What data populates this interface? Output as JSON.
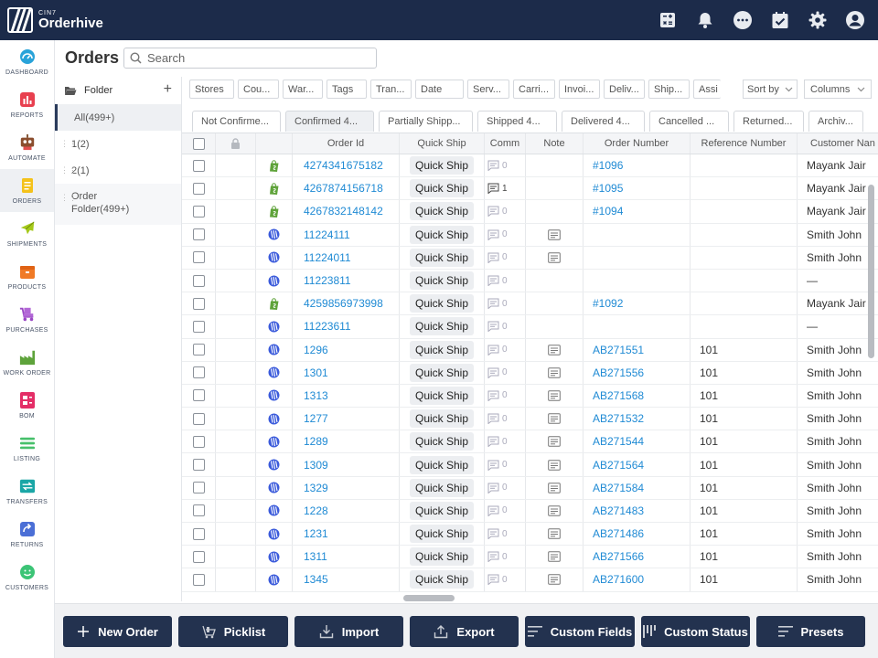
{
  "app": {
    "brand_small": "CIN7",
    "brand_name": "Orderhive"
  },
  "colors": {
    "topbar": "#1c2b4a",
    "link": "#1f8ad4",
    "button": "#23324f"
  },
  "top_icons": [
    "calculator-icon",
    "bell-icon",
    "chat-icon",
    "calendar-check-icon",
    "gear-icon",
    "user-avatar-icon"
  ],
  "sidebar": {
    "items": [
      {
        "label": "DASHBOARD",
        "icon": "dashboard-icon"
      },
      {
        "label": "REPORTS",
        "icon": "reports-icon"
      },
      {
        "label": "AUTOMATE",
        "icon": "robot-icon"
      },
      {
        "label": "ORDERS",
        "icon": "orders-icon"
      },
      {
        "label": "SHIPMENTS",
        "icon": "plane-icon"
      },
      {
        "label": "PRODUCTS",
        "icon": "box-icon"
      },
      {
        "label": "PURCHASES",
        "icon": "cart-icon"
      },
      {
        "label": "WORK ORDER",
        "icon": "factory-icon"
      },
      {
        "label": "BOM",
        "icon": "bom-icon"
      },
      {
        "label": "LISTING",
        "icon": "listing-icon"
      },
      {
        "label": "TRANSFERS",
        "icon": "transfer-icon"
      },
      {
        "label": "RETURNS",
        "icon": "return-icon"
      },
      {
        "label": "CUSTOMERS",
        "icon": "customer-icon"
      }
    ]
  },
  "header": {
    "title": "Orders",
    "search_placeholder": "Search"
  },
  "folders": {
    "title": "Folder",
    "add": "+",
    "items": [
      "All(499+)",
      "1(2)",
      "2(1)",
      "Order Folder(499+)"
    ]
  },
  "filters": [
    "Stores",
    "Cou...",
    "War...",
    "Tags",
    "Tran...",
    "Date",
    "Serv...",
    "Carri...",
    "Invoi...",
    "Deliv...",
    "Ship...",
    "Assi"
  ],
  "sort_by": "Sort by",
  "columns_select": "Columns",
  "status_tabs": [
    "Not Confirme...",
    "Confirmed 4...",
    "Partially Shipp...",
    "Shipped 4...",
    "Delivered 4...",
    "Cancelled ...",
    "Returned...",
    "Archiv..."
  ],
  "table": {
    "headers": {
      "order_id": "Order Id",
      "quick_ship": "Quick Ship",
      "comm": "Comm",
      "note": "Note",
      "order_number": "Order Number",
      "reference_number": "Reference Number",
      "customer_name": "Customer Nan"
    },
    "rows": [
      {
        "store": "shopify",
        "order_id": "4274341675182",
        "quick_ship": "Quick Ship",
        "comments": "0",
        "note": false,
        "order_number": "#1096",
        "reference": "",
        "customer": "Mayank Jair"
      },
      {
        "store": "shopify",
        "order_id": "4267874156718",
        "quick_ship": "Quick Ship",
        "comments": "1",
        "note": false,
        "order_number": "#1095",
        "reference": "",
        "customer": "Mayank Jair"
      },
      {
        "store": "shopify",
        "order_id": "4267832148142",
        "quick_ship": "Quick Ship",
        "comments": "0",
        "note": false,
        "order_number": "#1094",
        "reference": "",
        "customer": "Mayank Jair"
      },
      {
        "store": "orderhive",
        "order_id": "11224111",
        "quick_ship": "Quick Ship",
        "comments": "0",
        "note": true,
        "order_number": "",
        "reference": "",
        "customer": "Smith John"
      },
      {
        "store": "orderhive",
        "order_id": "11224011",
        "quick_ship": "Quick Ship",
        "comments": "0",
        "note": true,
        "order_number": "",
        "reference": "",
        "customer": "Smith John"
      },
      {
        "store": "orderhive",
        "order_id": "11223811",
        "quick_ship": "Quick Ship",
        "comments": "0",
        "note": false,
        "order_number": "",
        "reference": "",
        "customer": "—"
      },
      {
        "store": "shopify",
        "order_id": "4259856973998",
        "quick_ship": "Quick Ship",
        "comments": "0",
        "note": false,
        "order_number": "#1092",
        "reference": "",
        "customer": "Mayank Jair"
      },
      {
        "store": "orderhive",
        "order_id": "11223611",
        "quick_ship": "Quick Ship",
        "comments": "0",
        "note": false,
        "order_number": "",
        "reference": "",
        "customer": "—"
      },
      {
        "store": "orderhive",
        "order_id": "1296",
        "quick_ship": "Quick Ship",
        "comments": "0",
        "note": true,
        "order_number": "AB271551",
        "reference": "101",
        "customer": "Smith John"
      },
      {
        "store": "orderhive",
        "order_id": "1301",
        "quick_ship": "Quick Ship",
        "comments": "0",
        "note": true,
        "order_number": "AB271556",
        "reference": "101",
        "customer": "Smith John"
      },
      {
        "store": "orderhive",
        "order_id": "1313",
        "quick_ship": "Quick Ship",
        "comments": "0",
        "note": true,
        "order_number": "AB271568",
        "reference": "101",
        "customer": "Smith John"
      },
      {
        "store": "orderhive",
        "order_id": "1277",
        "quick_ship": "Quick Ship",
        "comments": "0",
        "note": true,
        "order_number": "AB271532",
        "reference": "101",
        "customer": "Smith John"
      },
      {
        "store": "orderhive",
        "order_id": "1289",
        "quick_ship": "Quick Ship",
        "comments": "0",
        "note": true,
        "order_number": "AB271544",
        "reference": "101",
        "customer": "Smith John"
      },
      {
        "store": "orderhive",
        "order_id": "1309",
        "quick_ship": "Quick Ship",
        "comments": "0",
        "note": true,
        "order_number": "AB271564",
        "reference": "101",
        "customer": "Smith John"
      },
      {
        "store": "orderhive",
        "order_id": "1329",
        "quick_ship": "Quick Ship",
        "comments": "0",
        "note": true,
        "order_number": "AB271584",
        "reference": "101",
        "customer": "Smith John"
      },
      {
        "store": "orderhive",
        "order_id": "1228",
        "quick_ship": "Quick Ship",
        "comments": "0",
        "note": true,
        "order_number": "AB271483",
        "reference": "101",
        "customer": "Smith John"
      },
      {
        "store": "orderhive",
        "order_id": "1231",
        "quick_ship": "Quick Ship",
        "comments": "0",
        "note": true,
        "order_number": "AB271486",
        "reference": "101",
        "customer": "Smith John"
      },
      {
        "store": "orderhive",
        "order_id": "1311",
        "quick_ship": "Quick Ship",
        "comments": "0",
        "note": true,
        "order_number": "AB271566",
        "reference": "101",
        "customer": "Smith John"
      },
      {
        "store": "orderhive",
        "order_id": "1345",
        "quick_ship": "Quick Ship",
        "comments": "0",
        "note": true,
        "order_number": "AB271600",
        "reference": "101",
        "customer": "Smith John"
      }
    ]
  },
  "bottom_bar": {
    "new_order": "New Order",
    "picklist": "Picklist",
    "import": "Import",
    "export": "Export",
    "custom_fields": "Custom Fields",
    "custom_status": "Custom Status",
    "presets": "Presets"
  }
}
